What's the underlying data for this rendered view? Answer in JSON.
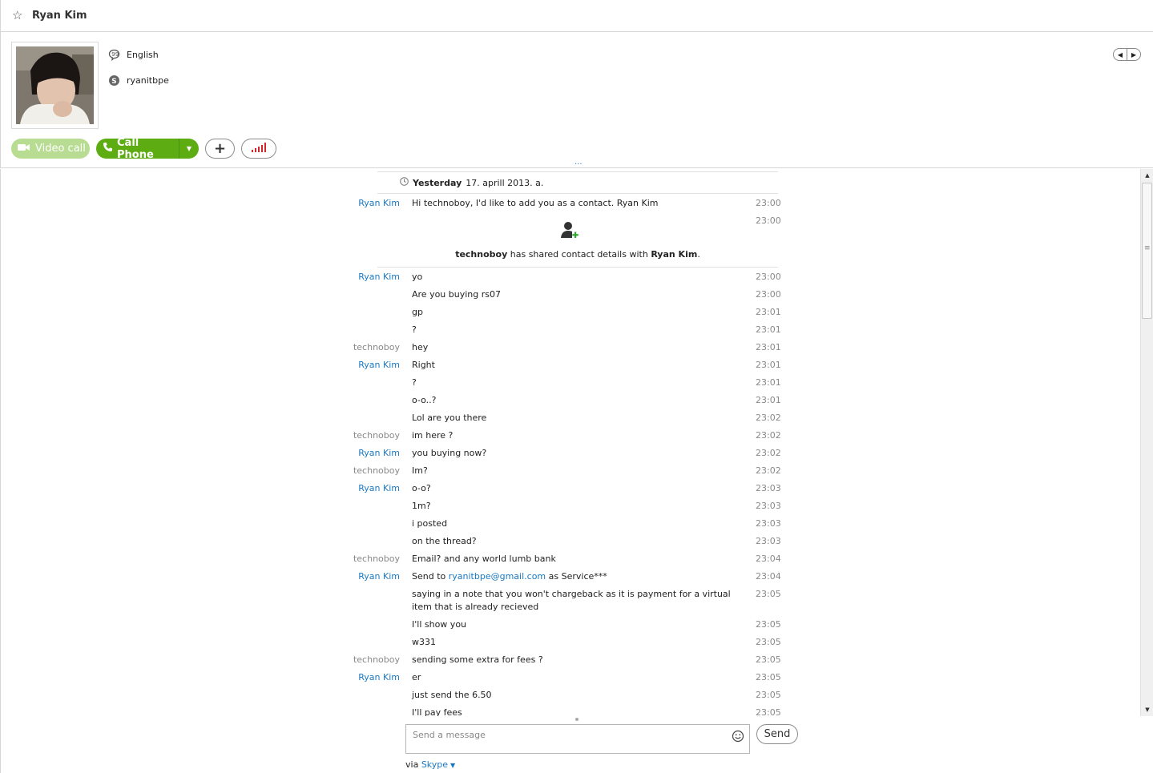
{
  "header": {
    "title": "Ryan Kim"
  },
  "profile": {
    "language": "English",
    "skype_name": "ryanitbpe"
  },
  "buttons": {
    "video_call": "Video call",
    "call_phone": "Call Phone"
  },
  "date_separator": {
    "day": "Yesterday",
    "date": "17. aprill 2013. a."
  },
  "first_message": {
    "sender": "Ryan Kim",
    "text": "Hi technoboy, I'd like to add you as a contact. Ryan Kim",
    "time": "23:00"
  },
  "contact_share": {
    "time": "23:00",
    "actor": "technoboy",
    "middle": "has shared contact details with",
    "target": "Ryan Kim",
    "end": "."
  },
  "messages": [
    {
      "sender": "Ryan Kim",
      "text": "yo",
      "time": "23:00"
    },
    {
      "sender": "",
      "text": "Are you buying rs07",
      "time": "23:00"
    },
    {
      "sender": "",
      "text": "gp",
      "time": "23:01"
    },
    {
      "sender": "",
      "text": "?",
      "time": "23:01"
    },
    {
      "sender": "technoboy",
      "text": "hey",
      "time": "23:01"
    },
    {
      "sender": "Ryan Kim",
      "text": "Right",
      "time": "23:01"
    },
    {
      "sender": "",
      "text": "?",
      "time": "23:01"
    },
    {
      "sender": "",
      "text": "o-o..?",
      "time": "23:01"
    },
    {
      "sender": "",
      "text": "Lol are you there",
      "time": "23:02"
    },
    {
      "sender": "technoboy",
      "text": "im here ?",
      "time": "23:02"
    },
    {
      "sender": "Ryan Kim",
      "text": "you buying now?",
      "time": "23:02"
    },
    {
      "sender": "technoboy",
      "text": "Im?",
      "time": "23:02"
    },
    {
      "sender": "Ryan Kim",
      "text": "o-o?",
      "time": "23:03"
    },
    {
      "sender": "",
      "text": "1m?",
      "time": "23:03"
    },
    {
      "sender": "",
      "text": "i posted",
      "time": "23:03"
    },
    {
      "sender": "",
      "text": "on the thread?",
      "time": "23:03"
    },
    {
      "sender": "technoboy",
      "text": "Email? and any world lumb bank",
      "time": "23:04"
    },
    {
      "sender": "Ryan Kim",
      "text_before": "Send to ",
      "link": "ryanitbpe@gmail.com",
      "text_after": " as Service***",
      "time": "23:04"
    },
    {
      "sender": "",
      "text": "saying in a note that you won't chargeback as it is payment for a virtual item that is already recieved",
      "time": "23:05"
    },
    {
      "sender": "",
      "text": "I'll show you",
      "time": "23:05"
    },
    {
      "sender": "",
      "text": "w331",
      "time": "23:05"
    },
    {
      "sender": "technoboy",
      "text": "sending some extra for fees ?",
      "time": "23:05"
    },
    {
      "sender": "Ryan Kim",
      "text": "er",
      "time": "23:05"
    },
    {
      "sender": "",
      "text": "just send the 6.50",
      "time": "23:05"
    },
    {
      "sender": "",
      "text": "I'll pay fees",
      "time": "23:05"
    }
  ],
  "compose": {
    "placeholder": "Send a message",
    "send_label": "Send",
    "via_label": "via",
    "via_service": "Skype"
  },
  "colors": {
    "call_green": "#5dac12",
    "video_green_disabled": "#b7dc92",
    "link_blue": "#1a79c3",
    "signal_red": "#d2262b"
  }
}
